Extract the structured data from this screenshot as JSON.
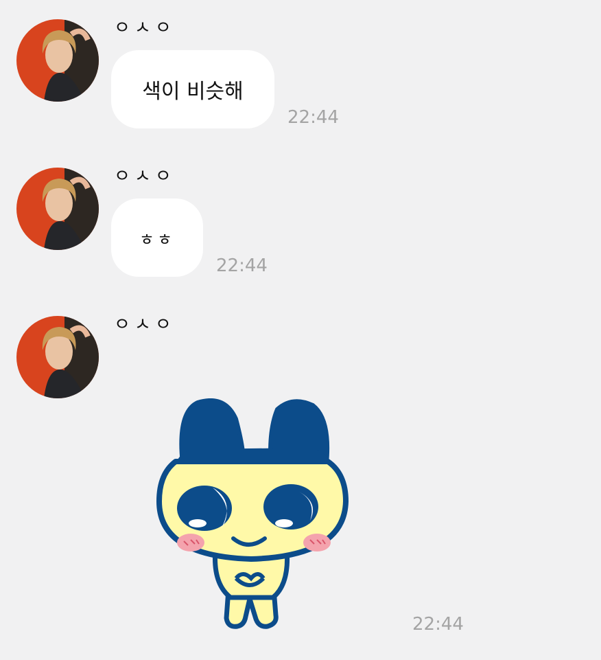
{
  "messages": [
    {
      "sender": "ㅇㅅㅇ",
      "text": "색이 비슷해",
      "time": "22:44"
    },
    {
      "sender": "ㅇㅅㅇ",
      "text": "ㅎㅎ",
      "time": "22:44"
    },
    {
      "sender": "ㅇㅅㅇ",
      "sticker": "mametchi-sticker",
      "time": "22:44"
    }
  ],
  "colors": {
    "background": "#f1f1f2",
    "bubble": "#ffffff",
    "time": "#a4a4a4",
    "sticker_blue": "#0c4c8a",
    "sticker_yellow": "#fff9a8",
    "blush": "#f4a3ad"
  }
}
